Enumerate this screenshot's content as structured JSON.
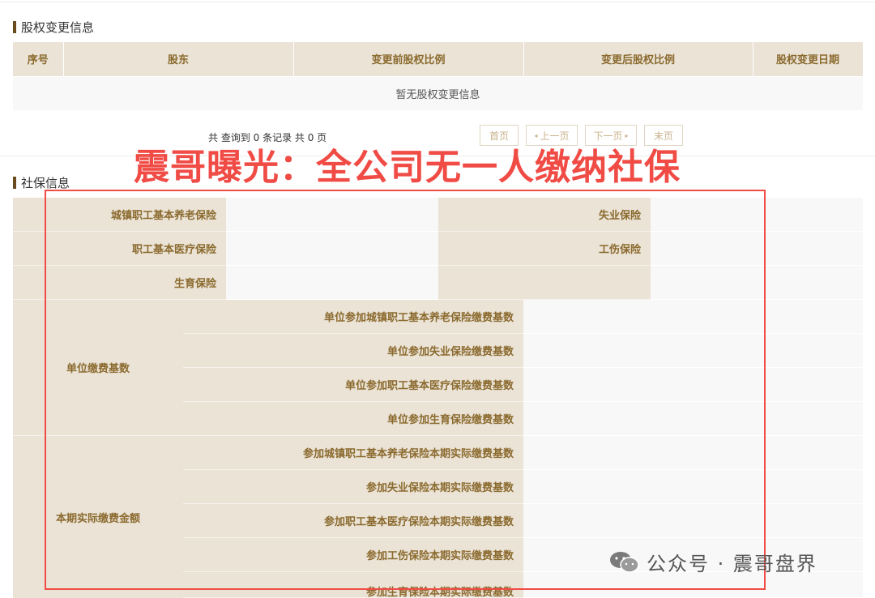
{
  "equity": {
    "title": "股权变更信息",
    "headers": [
      "序号",
      "股东",
      "变更前股权比例",
      "变更后股权比例",
      "股权变更日期"
    ],
    "empty_text": "暂无股权变更信息",
    "pagination_info": "共 查询到 0 条记录 共 0 页",
    "first": "首页",
    "prev": "上一页",
    "next": "下一页",
    "last": "末页"
  },
  "overlay_caption": "震哥曝光：全公司无一人缴纳社保",
  "social": {
    "title": "社保信息",
    "basic": [
      {
        "label": "城镇职工基本养老保险",
        "value": ""
      },
      {
        "label": "失业保险",
        "value": ""
      },
      {
        "label": "职工基本医疗保险",
        "value": ""
      },
      {
        "label": "工伤保险",
        "value": ""
      },
      {
        "label": "生育保险",
        "value": ""
      }
    ],
    "unit_base": {
      "group": "单位缴费基数",
      "rows": [
        "单位参加城镇职工基本养老保险缴费基数",
        "单位参加失业保险缴费基数",
        "单位参加职工基本医疗保险缴费基数",
        "单位参加生育保险缴费基数"
      ]
    },
    "actual_amount": {
      "group": "本期实际缴费金额",
      "rows": [
        "参加城镇职工基本养老保险本期实际缴费基数",
        "参加失业保险本期实际缴费基数",
        "参加职工基本医疗保险本期实际缴费基数",
        "参加工伤保险本期实际缴费基数",
        "参加生育保险本期实际缴费基数"
      ]
    }
  },
  "watermark": "公众号 · 震哥盘界",
  "colors": {
    "accent": "#8b6a2e",
    "header_bg": "#eae3d6",
    "overlay": "#f04b45"
  }
}
